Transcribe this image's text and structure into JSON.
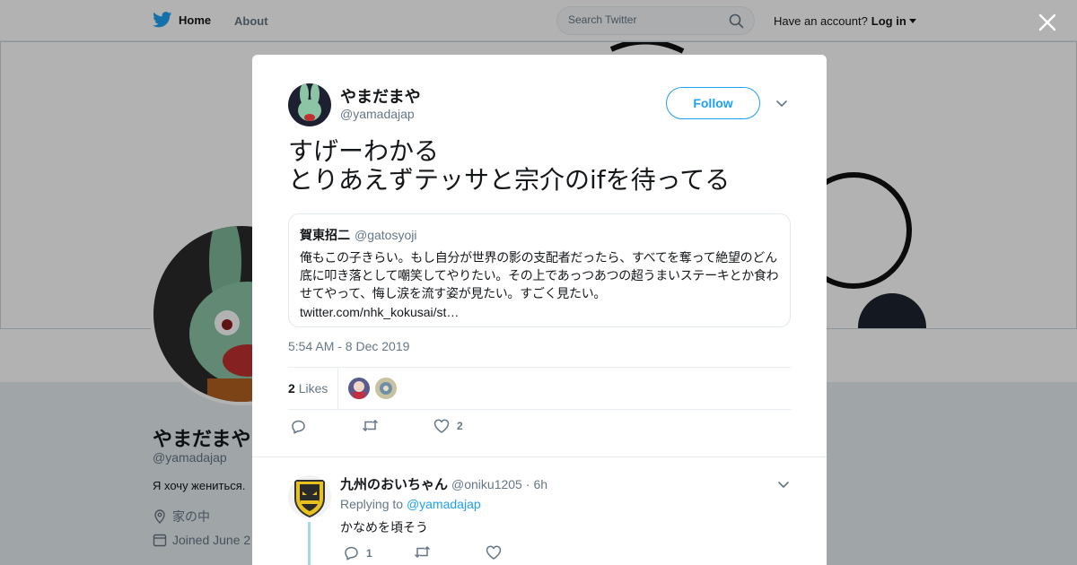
{
  "topbar": {
    "home_label": "Home",
    "about_label": "About",
    "search_placeholder": "Search Twitter",
    "account_prompt": "Have an account?",
    "login_label": "Log in"
  },
  "profile": {
    "name": "やまだまや",
    "handle": "@yamadajap",
    "bio": "Я хочу жениться.",
    "location": "家の中",
    "joined": "Joined June 2"
  },
  "tweet": {
    "author_name": "やまだまや",
    "author_handle": "@yamadajap",
    "follow_label": "Follow",
    "text": "すげーわかる\nとりあえずテッサと宗介のifを待ってる",
    "timestamp": "5:54 AM - 8 Dec 2019",
    "likes_count": "2",
    "likes_label": "Likes",
    "like_action_count": "2"
  },
  "quoted_tweet": {
    "name": "賀東招二",
    "handle": "@gatosyoji",
    "text": "俺もこの子きらい。もし自分が世界の影の支配者だったら、すべてを奪って絶望のどん底に叩き落として嘲笑してやりたい。その上であっつあつの超うまいステーキとか食わせてやって、悔し涙を流す姿が見たい。すごく見たい。",
    "link": "twitter.com/nhk_kokusai/st…"
  },
  "reply": {
    "name": "九州のおいちゃん",
    "handle": "@oniku1205",
    "separator": "·",
    "time": "6h",
    "replying_prefix": "Replying to",
    "replying_handle": "@yamadajap",
    "text": "かなめを頃そう",
    "reply_count": "1"
  },
  "colors": {
    "brand_blue": "#1da1f2",
    "text_primary": "#14171a",
    "text_secondary": "#657786",
    "border": "#e6ecf0",
    "thread_line": "#a3d8f5"
  },
  "icons": {
    "logo": "twitter-bird-icon",
    "search": "search-icon",
    "close": "close-icon",
    "caret": "chevron-down-icon",
    "reply": "reply-icon",
    "retweet": "retweet-icon",
    "like": "heart-icon",
    "location": "location-pin-icon",
    "calendar": "calendar-icon"
  }
}
